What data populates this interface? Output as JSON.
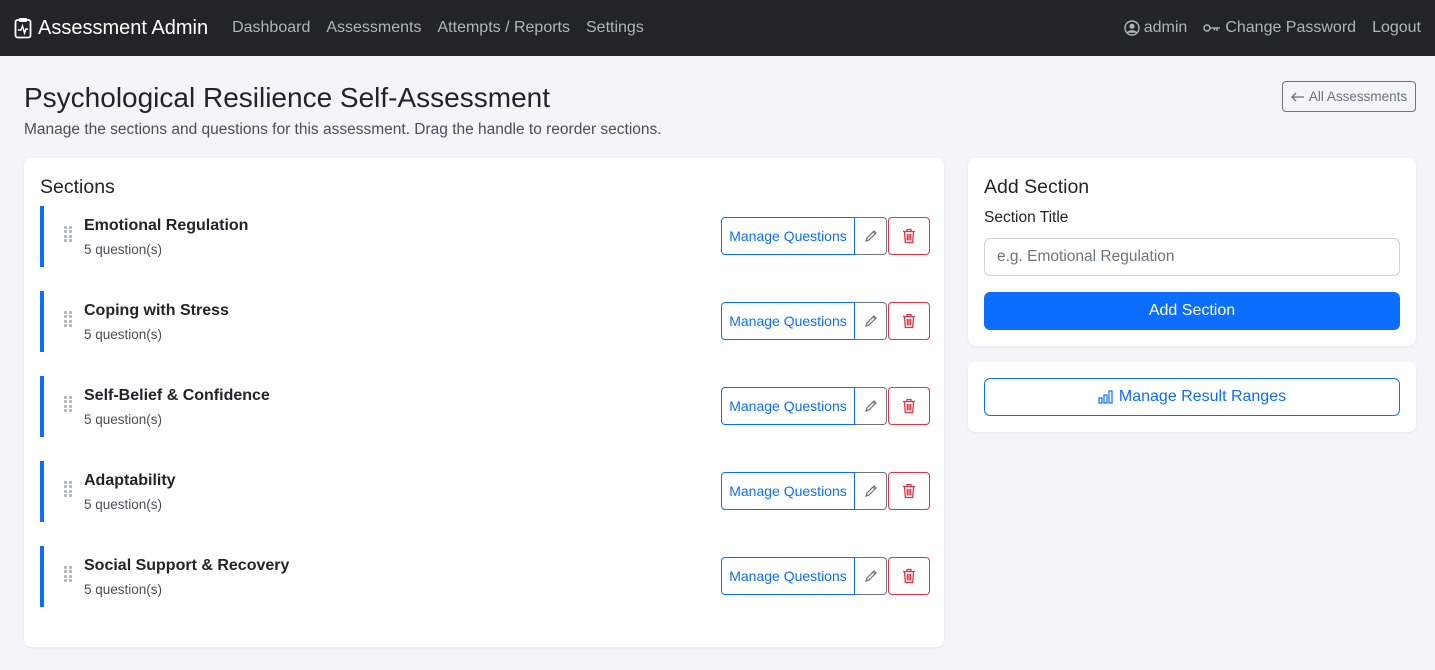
{
  "navbar": {
    "brand": "Assessment Admin",
    "brand_icon": "clipboard-pulse-icon",
    "links": [
      "Dashboard",
      "Assessments",
      "Attempts / Reports",
      "Settings"
    ],
    "user": "admin",
    "change_password": "Change Password",
    "logout": "Logout"
  },
  "header": {
    "title": "Psychological Resilience Self-Assessment",
    "subtitle": "Manage the sections and questions for this assessment. Drag the handle to reorder sections.",
    "back_button": "All Assessments"
  },
  "sections_card": {
    "title": "Sections",
    "manage_label": "Manage Questions",
    "items": [
      {
        "title": "Emotional Regulation",
        "count": "5 question(s)"
      },
      {
        "title": "Coping with Stress",
        "count": "5 question(s)"
      },
      {
        "title": "Self-Belief & Confidence",
        "count": "5 question(s)"
      },
      {
        "title": "Adaptability",
        "count": "5 question(s)"
      },
      {
        "title": "Social Support & Recovery",
        "count": "5 question(s)"
      }
    ]
  },
  "add_section": {
    "title": "Add Section",
    "field_label": "Section Title",
    "placeholder": "e.g. Emotional Regulation",
    "value": "",
    "button": "Add Section"
  },
  "result_ranges": {
    "button": "Manage Result Ranges"
  },
  "colors": {
    "navbar_bg": "#212529",
    "primary": "#0d6efd",
    "danger": "#dc3545",
    "secondary": "#6c757d",
    "page_bg": "#f3f5f9"
  }
}
